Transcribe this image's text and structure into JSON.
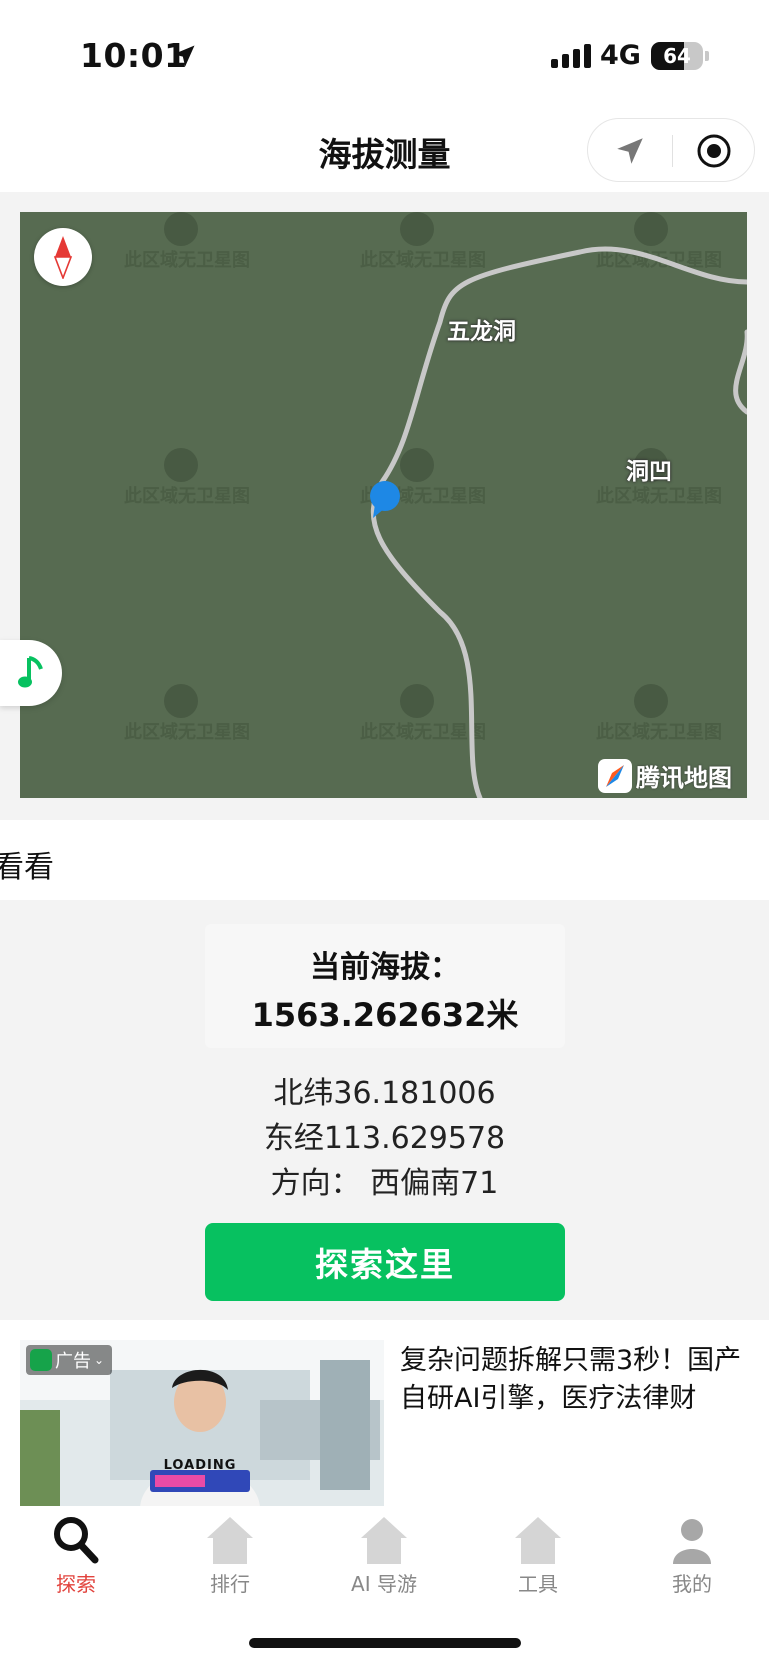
{
  "status_bar": {
    "time": "10:01",
    "network": "4G",
    "battery": "64",
    "battery_level": 0.64,
    "signal_bars": 4
  },
  "nav": {
    "title": "海拔测量"
  },
  "map": {
    "labels": [
      "五龙洞",
      "洞凹"
    ],
    "tile_notice": "此区域无卫星图",
    "logo_text": "腾讯地图",
    "background_color": "#576b51"
  },
  "marquee": {
    "text": "看看"
  },
  "info": {
    "altitude_label": "当前海拔：",
    "altitude_value": "1563.262632米",
    "latitude": "北纬36.181006",
    "longitude": "东经113.629578",
    "direction": "方向：  西偏南71",
    "explore_button": "探索这里",
    "accent_color": "#07c160"
  },
  "ad": {
    "badge": "广告",
    "image_caption": "LOADING",
    "title": "复杂问题拆解只需3秒！国产自研AI引擎，医疗法律财"
  },
  "tabbar": {
    "items": [
      {
        "label": "探索",
        "icon": "search-icon",
        "active": true
      },
      {
        "label": "排行",
        "icon": "home-icon",
        "active": false
      },
      {
        "label": "AI 导游",
        "icon": "home-icon",
        "active": false
      },
      {
        "label": "工具",
        "icon": "home-icon",
        "active": false
      },
      {
        "label": "我的",
        "icon": "user-icon",
        "active": false
      }
    ],
    "active_color": "#e2433d"
  }
}
